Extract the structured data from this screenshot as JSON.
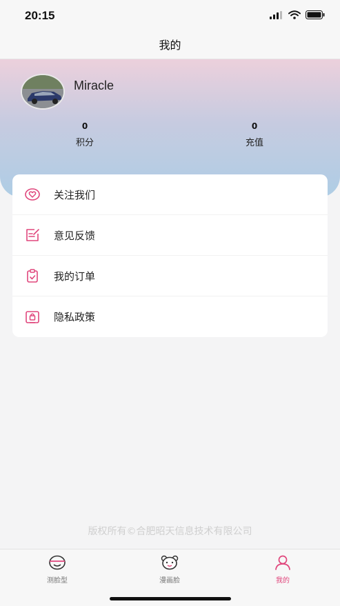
{
  "status_bar": {
    "time": "20:15"
  },
  "nav": {
    "title": "我的"
  },
  "profile": {
    "username": "Miracle",
    "stats": [
      {
        "value": "0",
        "label": "积分"
      },
      {
        "value": "0",
        "label": "充值"
      }
    ]
  },
  "menu": {
    "items": [
      {
        "label": "关注我们",
        "icon": "heart-badge-icon"
      },
      {
        "label": "意见反馈",
        "icon": "feedback-edit-icon"
      },
      {
        "label": "我的订单",
        "icon": "clipboard-check-icon"
      },
      {
        "label": "隐私政策",
        "icon": "privacy-lock-icon"
      }
    ]
  },
  "footer": {
    "copyright": "版权所有©合肥昭天信息技术有限公司"
  },
  "tabs": [
    {
      "label": "测脸型",
      "icon": "face-shape-icon",
      "active": false
    },
    {
      "label": "漫画脸",
      "icon": "cartoon-bear-icon",
      "active": false
    },
    {
      "label": "我的",
      "icon": "user-icon",
      "active": true
    }
  ],
  "colors": {
    "accent": "#e0467c",
    "menu_icon": "#e0467c",
    "card_bg": "#ffffff"
  }
}
